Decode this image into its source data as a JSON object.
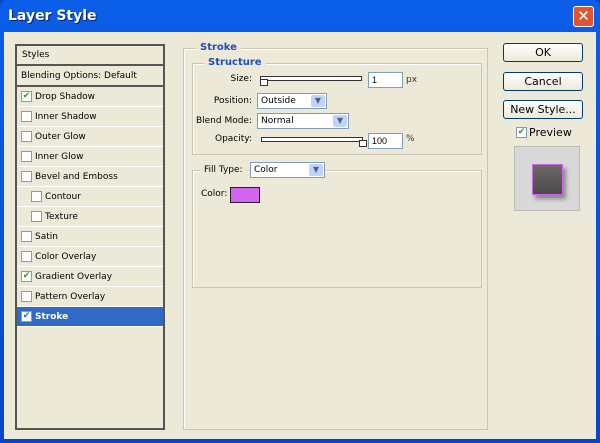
{
  "window": {
    "title": "Layer Style",
    "close": "✕"
  },
  "styles": {
    "header": "Styles",
    "blending": "Blending Options: Default",
    "items": [
      {
        "label": "Drop Shadow",
        "checked": true
      },
      {
        "label": "Inner Shadow",
        "checked": false
      },
      {
        "label": "Outer Glow",
        "checked": false
      },
      {
        "label": "Inner Glow",
        "checked": false
      },
      {
        "label": "Bevel and Emboss",
        "checked": false
      },
      {
        "label": "Contour",
        "checked": false,
        "indent": true
      },
      {
        "label": "Texture",
        "checked": false,
        "indent": true
      },
      {
        "label": "Satin",
        "checked": false
      },
      {
        "label": "Color Overlay",
        "checked": false
      },
      {
        "label": "Gradient Overlay",
        "checked": true
      },
      {
        "label": "Pattern Overlay",
        "checked": false
      },
      {
        "label": "Stroke",
        "checked": true,
        "selected": true
      }
    ]
  },
  "stroke": {
    "title": "Stroke",
    "structure": "Structure",
    "size_label": "Size:",
    "size": "1",
    "size_unit": "px",
    "size_fraction": 0.0,
    "position_label": "Position:",
    "position": "Outside",
    "blend_label": "Blend Mode:",
    "blend": "Normal",
    "opacity_label": "Opacity:",
    "opacity": "100",
    "opacity_unit": "%",
    "opacity_fraction": 1.0,
    "fill_type_label": "Fill Type:",
    "fill_type": "Color",
    "color_label": "Color:",
    "color": "#D264F0"
  },
  "buttons": {
    "ok": "OK",
    "cancel": "Cancel",
    "new_style": "New Style...",
    "preview": "Preview"
  }
}
